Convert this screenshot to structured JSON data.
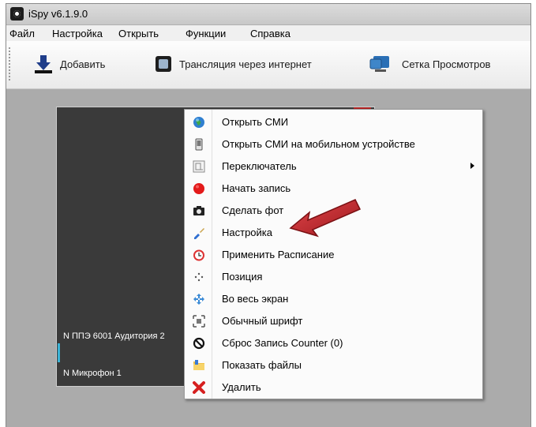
{
  "window": {
    "title": "iSpy v6.1.9.0"
  },
  "menubar": {
    "items": [
      "Файл",
      "Настройка",
      "Открыть",
      "Функции",
      "Справка"
    ]
  },
  "toolbar": {
    "add_label": "Добавить",
    "broadcast_label": "Трансляция через интернет",
    "grid_label": "Сетка Просмотров"
  },
  "camera": {
    "label": "N  ППЭ 6001 Аудитория 2",
    "mic_label": "N  Микрофон 1"
  },
  "context_menu": {
    "items": [
      {
        "label": "Открыть СМИ",
        "icon": "globe-icon"
      },
      {
        "label": "Открыть СМИ на мобильном устройстве",
        "icon": "mobile-phone-icon"
      },
      {
        "label": "Переключатель",
        "icon": "switch-icon",
        "submenu": true
      },
      {
        "label": "Начать запись",
        "icon": "record-icon"
      },
      {
        "label": "Сделать фот",
        "icon": "camera-icon"
      },
      {
        "label": "Настройка",
        "icon": "settings-brush-icon"
      },
      {
        "label": "Применить Расписание",
        "icon": "clock-icon"
      },
      {
        "label": "Позиция",
        "icon": "position-dots-icon"
      },
      {
        "label": "Во весь экран",
        "icon": "fullscreen-arrows-icon"
      },
      {
        "label": "Обычный шрифт",
        "icon": "normal-view-icon"
      },
      {
        "label": "Сброс Запись Counter (0)",
        "icon": "reset-circle-icon"
      },
      {
        "label": "Показать файлы",
        "icon": "folder-icon"
      },
      {
        "label": "Удалить",
        "icon": "delete-x-icon"
      }
    ]
  },
  "colors": {
    "record": "#e31a1a",
    "delete": "#d62020",
    "arrow": "#c0282a",
    "mic_bar": "#3bb3d6"
  }
}
